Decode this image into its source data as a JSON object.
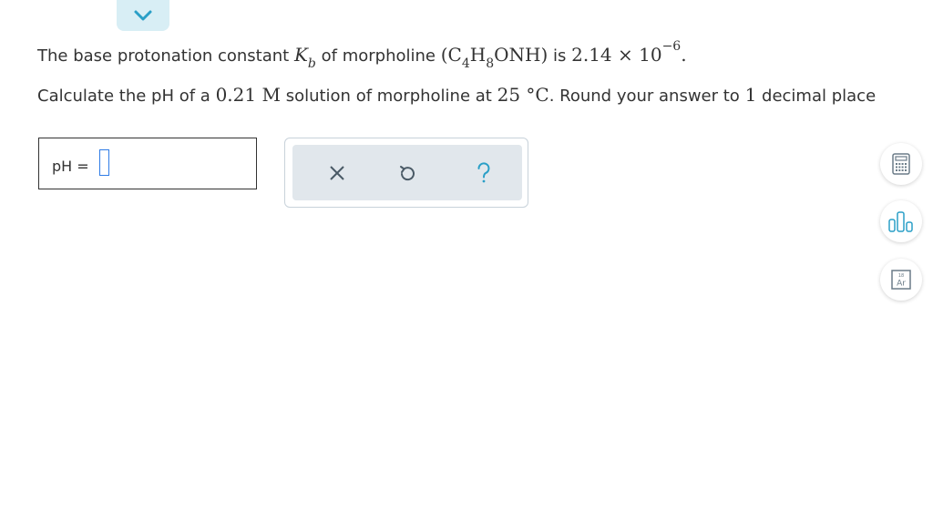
{
  "question": {
    "line1": {
      "pre": "The base protonation constant",
      "k_symbol": "K",
      "k_sub": "b",
      "of_text": "of morpholine",
      "formula_open": "(C",
      "sub_4": "4",
      "formula_h": "H",
      "sub_8": "8",
      "formula_rest": "ONH)",
      "is_text": "is",
      "value_mantissa": "2.14 × 10",
      "value_exp": "−6",
      "period": "."
    },
    "line2": {
      "pre": "Calculate the pH of a",
      "conc": "0.21 M",
      "mid": "solution of morpholine at",
      "temp": "25 °C",
      "round_text": ". Round your answer to",
      "decimals": "1",
      "post": "decimal place"
    }
  },
  "answer": {
    "label": "pH =",
    "value": ""
  },
  "tools": [
    {
      "name": "clear",
      "icon": "x-icon"
    },
    {
      "name": "undo",
      "icon": "undo-icon"
    },
    {
      "name": "help",
      "icon": "question-icon"
    }
  ],
  "side_tools": [
    {
      "name": "calculator",
      "icon": "calculator-icon"
    },
    {
      "name": "data",
      "icon": "bar-chart-icon"
    },
    {
      "name": "periodic-table",
      "icon": "periodic-table-icon",
      "element_number": "18",
      "element_symbol": "Ar"
    }
  ],
  "colors": {
    "accent": "#2a9fc7",
    "collapse_bg": "#d8eef5",
    "tool_bg": "#e1e7ec",
    "input_border": "#2f7ce6",
    "icon_gray": "#6b7c88"
  }
}
